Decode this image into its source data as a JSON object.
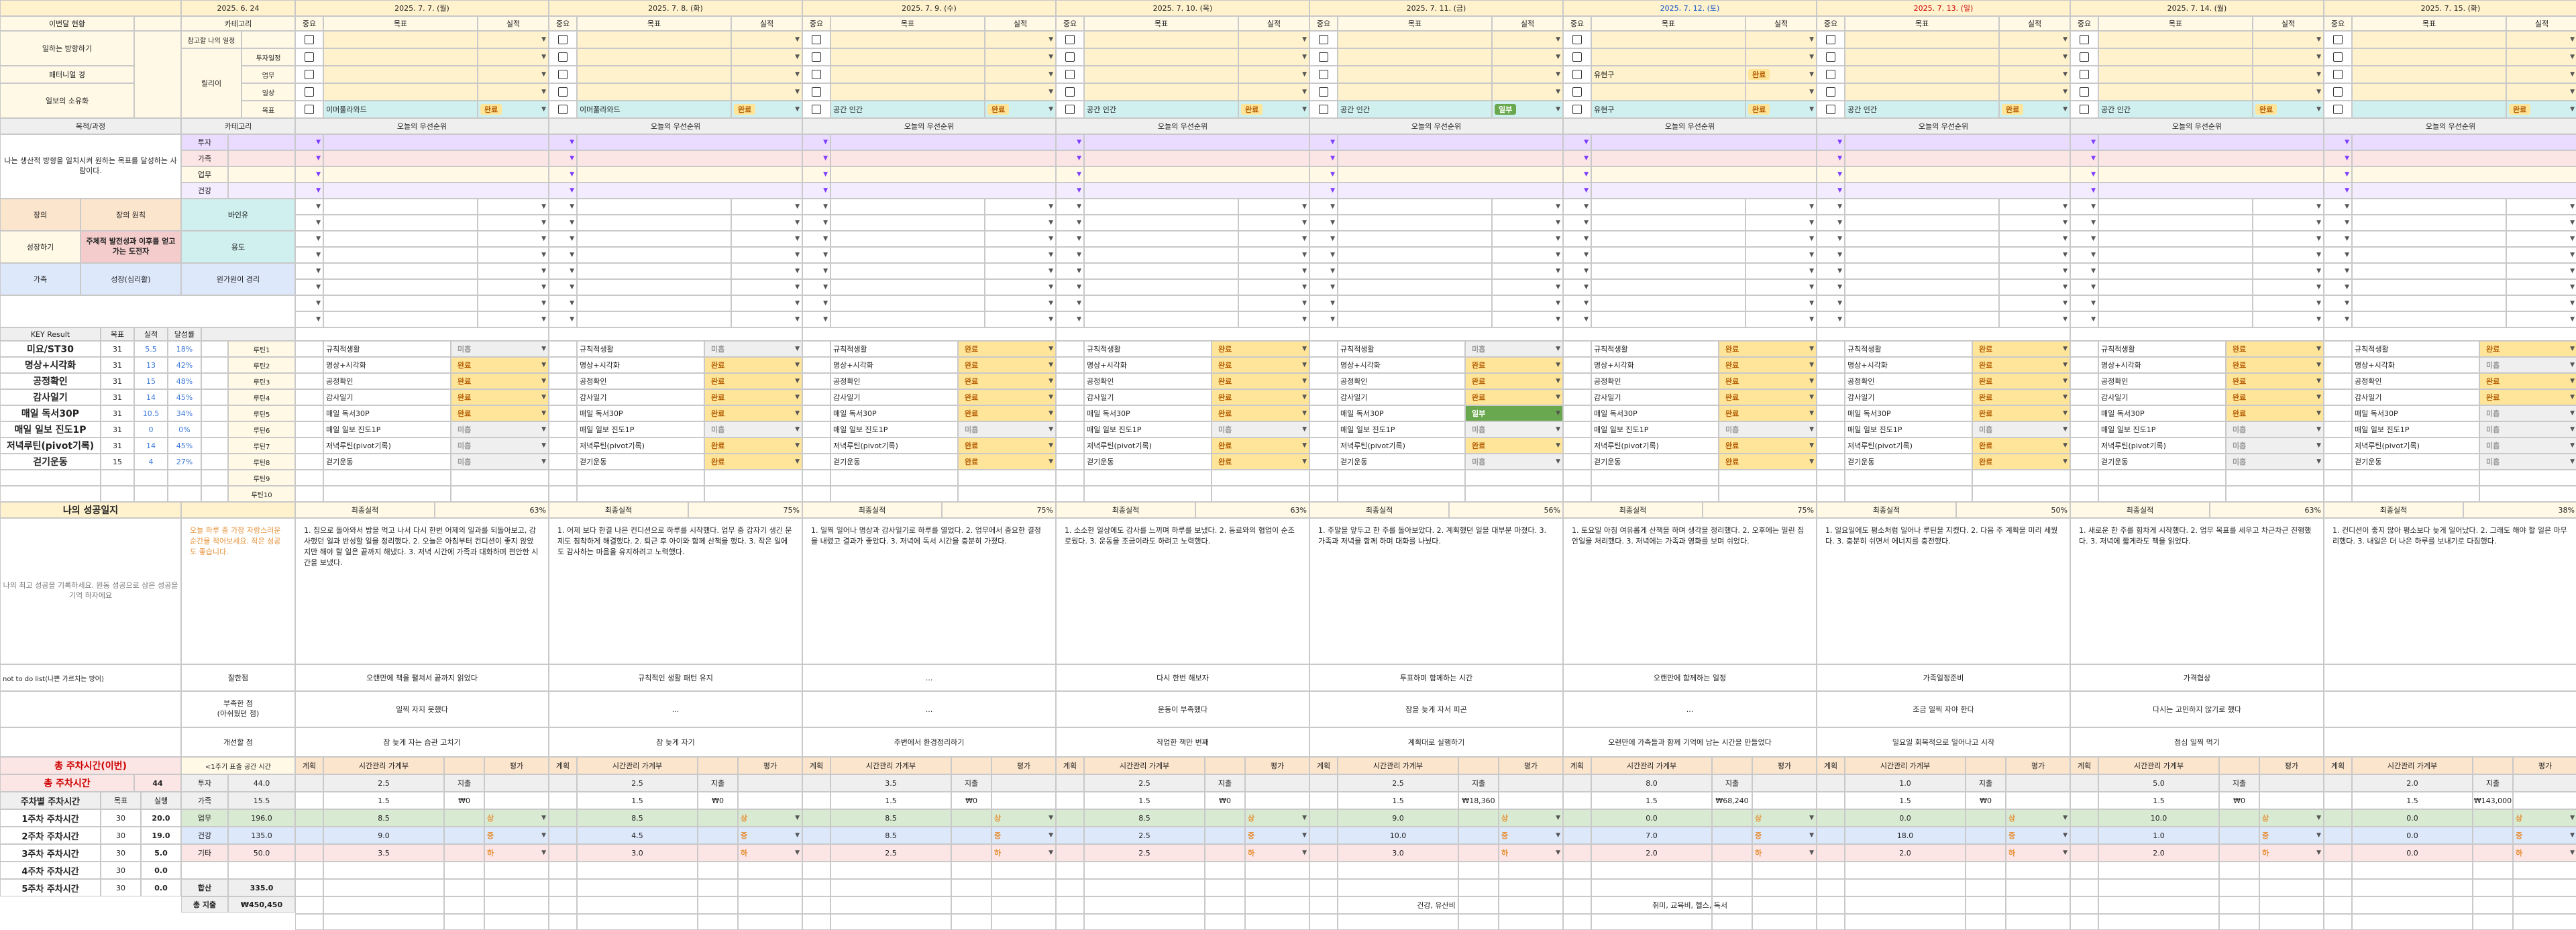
{
  "dates": [
    "2025. 6. 24",
    "2025. 7. 7. (월)",
    "2025. 7. 8. (화)",
    "2025. 7. 9. (수)",
    "2025. 7. 10. (목)",
    "2025. 7. 11. (금)",
    "2025. 7. 12. (토)",
    "2025. 7. 13. (일)",
    "2025. 7. 14. (월)",
    "2025. 7. 15. (화)"
  ],
  "left": {
    "priority": "이번달 현황",
    "rows": [
      "일하는 방향하기",
      "패터니얼 경",
      "일보의 소유화"
    ],
    "purpose_title": "목적/과정",
    "purpose_text": "나는 생산적 방향을 일치시켜 원하는 목표를 달성하는 사람이다.",
    "ideal": [
      "장의",
      "장의 원칙",
      "바인유"
    ],
    "ideal2": [
      "성장하기",
      "주체적 발전성과 이후를 얻고 가는 도전자",
      "용도"
    ],
    "ideal3": [
      "가족",
      "성장(심리활)",
      "원가원이 경리"
    ],
    "life_title": "나의 성공일지",
    "life_text": "나의 최고 성공을 기록하세요. 원동 성공으로 삼은 성공을 기억 하자에요",
    "notdo": "not to do list(나쁜 가르치는 방어)",
    "total_title": "총 주차시간(이번)",
    "total_label": "총 주차시간",
    "total_value": "44"
  },
  "categories": {
    "label": "카테고리",
    "items": [
      "참고할 나의 일정",
      "투자일정",
      "업무",
      "일상",
      "목표"
    ],
    "sub_label": "릴리이",
    "cat2": [
      "투자",
      "가족",
      "업무",
      "건강"
    ]
  },
  "kr": {
    "headers": [
      "KEY Result",
      "목표",
      "실적",
      "달성률"
    ],
    "rows": [
      {
        "name": "미요/ST30",
        "goal": "31",
        "done": "5.5",
        "pct": "18%",
        "tag": "루틴1"
      },
      {
        "name": "명상+시각화",
        "goal": "31",
        "done": "13",
        "pct": "42%",
        "tag": "루틴2"
      },
      {
        "name": "공정확인",
        "goal": "31",
        "done": "15",
        "pct": "48%",
        "tag": "루틴3"
      },
      {
        "name": "감사일기",
        "goal": "31",
        "done": "14",
        "pct": "45%",
        "tag": "루틴4"
      },
      {
        "name": "매일 독서30P",
        "goal": "31",
        "done": "10.5",
        "pct": "34%",
        "tag": "루틴5"
      },
      {
        "name": "매일 일보 진도1P",
        "goal": "31",
        "done": "0",
        "pct": "0%",
        "tag": "루틴6"
      },
      {
        "name": "저녁루틴(pivot기록)",
        "goal": "31",
        "done": "14",
        "pct": "45%",
        "tag": "루틴7"
      },
      {
        "name": "걷기운동",
        "goal": "15",
        "done": "4",
        "pct": "27%",
        "tag": "루틴8"
      },
      {
        "name": "",
        "goal": "",
        "done": "",
        "pct": "",
        "tag": "루틴9"
      },
      {
        "name": "",
        "goal": "",
        "done": "",
        "pct": "",
        "tag": "루틴10"
      }
    ]
  },
  "weekly": {
    "cols": [
      "주차",
      "목표",
      "실행"
    ],
    "rows": [
      {
        "name": "주차별 주차시간",
        "goal": "",
        "done": ""
      },
      {
        "name": "1주차 주차시간",
        "goal": "30",
        "done": "20.0"
      },
      {
        "name": "2주차 주차시간",
        "goal": "30",
        "done": "19.0"
      },
      {
        "name": "3주차 주차시간",
        "goal": "30",
        "done": "5.0"
      },
      {
        "name": "4주차 주차시간",
        "goal": "30",
        "done": "0.0"
      },
      {
        "name": "5주차 주차시간",
        "goal": "30",
        "done": "0.0"
      }
    ],
    "summary": [
      {
        "k": "투자",
        "v": "44.0"
      },
      {
        "k": "가족",
        "v": "15.5"
      },
      {
        "k": "업무",
        "v": "196.0"
      },
      {
        "k": "건강",
        "v": "135.0"
      },
      {
        "k": "기타",
        "v": "50.0"
      },
      {
        "k": "",
        "v": ""
      },
      {
        "k": "합산",
        "v": "335.0"
      },
      {
        "k": "총 지출",
        "v": "₩450,450"
      }
    ],
    "summary_header": "<1주기 표출 공간 시간"
  },
  "day_headers": {
    "importance": "중요",
    "goal": "목표",
    "result": "실적",
    "priority": "오늘의 우선순위",
    "final": "최종실적",
    "plan": "계획",
    "time_label": "시간관리 가계부",
    "eval": "평가"
  },
  "days": [
    {
      "done": "완료",
      "routine": "이머풀라와드",
      "top": [
        "",
        "",
        "",
        ""
      ],
      "routines": [
        "규칙적생활",
        "명상+시각화",
        "공정확인",
        "감사일기",
        "매일 독서30P",
        "매일 일보 진도1P",
        "저녁루틴(pivot기록)",
        "걷기운동"
      ],
      "status": [
        "미흡",
        "완료",
        "완료",
        "완료",
        "완료",
        "미흡",
        "미흡",
        "미흡"
      ],
      "final": "63%",
      "diary": "1. 집으로 돌아와서 밥을 먹고 나서 다시 한번 어제의 일과를 되돌아보고, 감사했던 일과 반성할 일을 정리했다. 2. 오늘은 아침부터 컨디션이 좋지 않았지만 해야 할 일은 끝까지 해냈다. 3. 저녁 시간에 가족과 대화하며 편안한 시간을 보냈다.",
      "good": "오랜만에 책을 펼쳐서 끝까지 읽었다",
      "bad": "일찍 자지 못했다",
      "improve": "잠 늦게 자는 습관 고치기",
      "time": [
        "2.5",
        "1.5",
        "8.5",
        "9.0",
        "3.5"
      ],
      "money": [
        "지출",
        "₩0",
        "",
        "",
        ""
      ],
      "grade": [
        "",
        "",
        "상",
        "중",
        "하"
      ]
    },
    {
      "done": "완료",
      "routine": "이머풀라와드",
      "top": [
        "",
        "",
        "",
        ""
      ],
      "routines": [
        "규칙적생활",
        "명상+시각화",
        "공정확인",
        "감사일기",
        "매일 독서30P",
        "매일 일보 진도1P",
        "저녁루틴(pivot기록)",
        "걷기운동"
      ],
      "status": [
        "미흡",
        "완료",
        "완료",
        "완료",
        "완료",
        "미흡",
        "완료",
        "완료"
      ],
      "final": "75%",
      "diary": "1. 어제 보다 한결 나은 컨디션으로 하루를 시작했다. 업무 중 갑자기 생긴 문제도 침착하게 해결했다. 2. 퇴근 후 아이와 함께 산책을 했다. 3. 작은 일에도 감사하는 마음을 유지하려고 노력했다.",
      "good": "규칙적인 생활 패턴 유지",
      "bad": "...",
      "improve": "잠 늦게 자기",
      "time": [
        "2.5",
        "1.5",
        "8.5",
        "4.5",
        "3.0"
      ],
      "money": [
        "지출",
        "₩0",
        "",
        "",
        ""
      ],
      "grade": [
        "",
        "",
        "상",
        "중",
        "하"
      ]
    },
    {
      "done": "완료",
      "routine": "공간 인간",
      "top": [
        "",
        "",
        "",
        ""
      ],
      "routines": [
        "규칙적생활",
        "명상+시각화",
        "공정확인",
        "감사일기",
        "매일 독서30P",
        "매일 일보 진도1P",
        "저녁루틴(pivot기록)",
        "걷기운동"
      ],
      "status": [
        "완료",
        "완료",
        "완료",
        "완료",
        "완료",
        "미흡",
        "완료",
        "완료"
      ],
      "final": "75%",
      "diary": "1. 일찍 일어나 명상과 감사일기로 하루를 열었다. 2. 업무에서 중요한 결정을 내렸고 결과가 좋았다. 3. 저녁에 독서 시간을 충분히 가졌다.",
      "good": "...",
      "bad": "...",
      "improve": "주변에서 환경정리하기",
      "time": [
        "3.5",
        "1.5",
        "8.5",
        "8.5",
        "2.5"
      ],
      "money": [
        "지출",
        "₩0",
        "",
        "",
        ""
      ],
      "grade": [
        "",
        "",
        "상",
        "중",
        "하"
      ]
    },
    {
      "done": "완료",
      "routine": "공간 인간",
      "top": [
        "",
        "",
        "",
        ""
      ],
      "routines": [
        "규칙적생활",
        "명상+시각화",
        "공정확인",
        "감사일기",
        "매일 독서30P",
        "매일 일보 진도1P",
        "저녁루틴(pivot기록)",
        "걷기운동"
      ],
      "status": [
        "완료",
        "완료",
        "완료",
        "완료",
        "완료",
        "미흡",
        "완료",
        "완료"
      ],
      "final": "63%",
      "diary": "1. 소소한 일상에도 감사를 느끼며 하루를 보냈다. 2. 동료와의 협업이 순조로웠다. 3. 운동을 조금이라도 하려고 노력했다.",
      "good": "다시 한번 해보자",
      "bad": "운동이 부족했다",
      "improve": "작업한 책만 번째",
      "time": [
        "2.5",
        "1.5",
        "8.5",
        "2.5",
        "2.5"
      ],
      "money": [
        "지출",
        "₩0",
        "",
        "",
        ""
      ],
      "grade": [
        "",
        "",
        "상",
        "중",
        "하"
      ]
    },
    {
      "done": "일부",
      "routine": "공간 인간",
      "top": [
        "",
        "",
        "",
        ""
      ],
      "routines": [
        "규칙적생활",
        "명상+시각화",
        "공정확인",
        "감사일기",
        "매일 독서30P",
        "매일 일보 진도1P",
        "저녁루틴(pivot기록)",
        "걷기운동"
      ],
      "status": [
        "미흡",
        "완료",
        "완료",
        "완료",
        "일부",
        "미흡",
        "완료",
        "미흡"
      ],
      "final": "56%",
      "diary": "1. 주말을 앞두고 한 주를 돌아보았다. 2. 계획했던 일을 대부분 마쳤다. 3. 가족과 저녁을 함께 하며 대화를 나눴다.",
      "good": "투표하며 함께하는 시간",
      "bad": "잠을 늦게 자서 피곤",
      "improve": "계획대로 실행하기",
      "time": [
        "2.5",
        "1.5",
        "9.0",
        "10.0",
        "3.0"
      ],
      "money": [
        "지출",
        "₩18,360",
        "",
        "",
        ""
      ],
      "grade": [
        "",
        "",
        "상",
        "중",
        "하"
      ]
    },
    {
      "done": "완료",
      "routine": "유현구",
      "top": [
        "완료",
        "",
        "",
        ""
      ],
      "routines": [
        "규칙적생활",
        "명상+시각화",
        "공정확인",
        "감사일기",
        "매일 독서30P",
        "매일 일보 진도1P",
        "저녁루틴(pivot기록)",
        "걷기운동"
      ],
      "status": [
        "완료",
        "완료",
        "완료",
        "완료",
        "완료",
        "미흡",
        "완료",
        "완료"
      ],
      "final": "75%",
      "diary": "1. 토요일 아침 여유롭게 산책을 하며 생각을 정리했다. 2. 오후에는 밀린 집안일을 처리했다. 3. 저녁에는 가족과 영화를 보며 쉬었다.",
      "good": "오랜만에 함께하는 일정",
      "bad": "...",
      "improve": "오랜만에 가족들과 함께 기억에 남는 시간을 만들었다",
      "time": [
        "8.0",
        "1.5",
        "0.0",
        "7.0",
        "2.0"
      ],
      "money": [
        "지출",
        "₩68,240",
        "",
        "",
        ""
      ],
      "grade": [
        "",
        "",
        "상",
        "중",
        "하"
      ]
    },
    {
      "done": "완료",
      "routine": "공간 인간",
      "top": [
        "",
        "",
        "",
        ""
      ],
      "routines": [
        "규칙적생활",
        "명상+시각화",
        "공정확인",
        "감사일기",
        "매일 독서30P",
        "매일 일보 진도1P",
        "저녁루틴(pivot기록)",
        "걷기운동"
      ],
      "status": [
        "완료",
        "완료",
        "완료",
        "완료",
        "완료",
        "미흡",
        "완료",
        "완료"
      ],
      "final": "50%",
      "diary": "1. 일요일에도 평소처럼 일어나 루틴을 지켰다. 2. 다음 주 계획을 미리 세웠다. 3. 충분히 쉬면서 에너지를 충전했다.",
      "good": "가족일정준비",
      "bad": "조금 일찍 자야 한다",
      "improve": "일요일 회복적으로 일어나고 시작",
      "time": [
        "1.0",
        "1.5",
        "0.0",
        "18.0",
        "2.0"
      ],
      "money": [
        "지출",
        "₩0",
        "",
        "",
        ""
      ],
      "grade": [
        "",
        "",
        "상",
        "중",
        "하"
      ]
    },
    {
      "done": "완료",
      "routine": "공간 인간",
      "top": [
        "",
        "",
        "",
        ""
      ],
      "routines": [
        "규칙적생활",
        "명상+시각화",
        "공정확인",
        "감사일기",
        "매일 독서30P",
        "매일 일보 진도1P",
        "저녁루틴(pivot기록)",
        "걷기운동"
      ],
      "status": [
        "완료",
        "완료",
        "완료",
        "완료",
        "완료",
        "미흡",
        "미흡",
        "미흡"
      ],
      "final": "63%",
      "diary": "1. 새로운 한 주를 힘차게 시작했다. 2. 업무 목표를 세우고 차근차근 진행했다. 3. 저녁에 짧게라도 책을 읽었다.",
      "good": "가격협상",
      "bad": "다시는 고민하지 않기로 했다",
      "improve": "점심 일찍 먹기",
      "time": [
        "5.0",
        "1.5",
        "10.0",
        "1.0",
        "2.0"
      ],
      "money": [
        "지출",
        "₩0",
        "",
        "",
        ""
      ],
      "grade": [
        "",
        "",
        "상",
        "중",
        "하"
      ]
    },
    {
      "done": "완료",
      "routine": "",
      "top": [
        "",
        "",
        "",
        ""
      ],
      "routines": [
        "규칙적생활",
        "명상+시각화",
        "공정확인",
        "감사일기",
        "매일 독서30P",
        "매일 일보 진도1P",
        "저녁루틴(pivot기록)",
        "걷기운동"
      ],
      "status": [
        "완료",
        "미흡",
        "완료",
        "완료",
        "미흡",
        "미흡",
        "미흡",
        "미흡"
      ],
      "final": "38%",
      "diary": "1. 컨디션이 좋지 않아 평소보다 늦게 일어났다. 2. 그래도 해야 할 일은 마무리했다. 3. 내일은 더 나은 하루를 보내기로 다짐했다.",
      "good": "",
      "bad": "",
      "improve": "",
      "time": [
        "2.0",
        "1.5",
        "0.0",
        "0.0",
        "0.0"
      ],
      "money": [
        "지출",
        "₩143,000",
        "",
        "",
        ""
      ],
      "grade": [
        "",
        "",
        "상",
        "중",
        "하"
      ]
    }
  ],
  "footer_notes": [
    "건강, 유산비",
    "취미, 교육비, 헬스, 독서"
  ]
}
